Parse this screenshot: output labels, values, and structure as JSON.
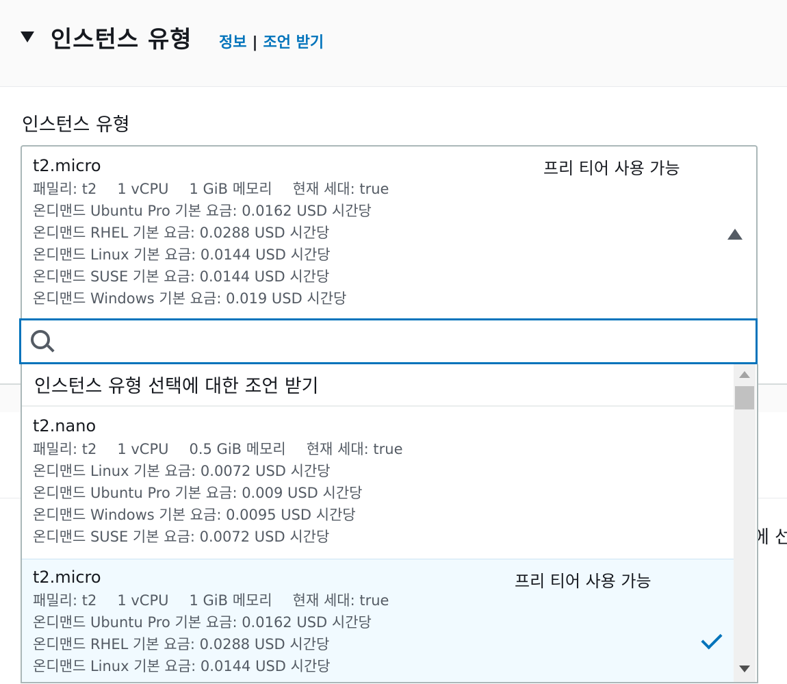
{
  "header": {
    "title": "인스턴스 유형",
    "info_link": "정보",
    "separator": "|",
    "advice_link": "조언 받기"
  },
  "field_label": "인스턴스 유형",
  "background_peek": "에 선",
  "selected": {
    "name": "t2.micro",
    "tag": "프리 티어 사용 가능",
    "family": "패밀리: t2",
    "vcpu": "1 vCPU",
    "memory": "1 GiB 메모리",
    "generation": "현재 세대: true",
    "prices": [
      "온디맨드 Ubuntu Pro 기본 요금: 0.0162 USD 시간당",
      "온디맨드 RHEL 기본 요금: 0.0288 USD 시간당",
      "온디맨드 Linux 기본 요금: 0.0144 USD 시간당",
      "온디맨드 SUSE 기본 요금: 0.0144 USD 시간당",
      "온디맨드 Windows 기본 요금: 0.019 USD 시간당"
    ]
  },
  "search": {
    "placeholder": "",
    "value": ""
  },
  "list": {
    "advice_text": "인스턴스 유형 선택에 대한 조언 받기",
    "items": [
      {
        "name": "t2.nano",
        "tag": "",
        "family": "패밀리: t2",
        "vcpu": "1 vCPU",
        "memory": "0.5 GiB 메모리",
        "generation": "현재 세대: true",
        "prices": [
          "온디맨드 Linux 기본 요금: 0.0072 USD 시간당",
          "온디맨드 Ubuntu Pro 기본 요금: 0.009 USD 시간당",
          "온디맨드 Windows 기본 요금: 0.0095 USD 시간당",
          "온디맨드 SUSE 기본 요금: 0.0072 USD 시간당"
        ]
      },
      {
        "name": "t2.micro",
        "tag": "프리 티어 사용 가능",
        "family": "패밀리: t2",
        "vcpu": "1 vCPU",
        "memory": "1 GiB 메모리",
        "generation": "현재 세대: true",
        "prices": [
          "온디맨드 Ubuntu Pro 기본 요금: 0.0162 USD 시간당",
          "온디맨드 RHEL 기본 요금: 0.0288 USD 시간당",
          "온디맨드 Linux 기본 요금: 0.0144 USD 시간당"
        ]
      }
    ]
  },
  "colors": {
    "link": "#0073bb",
    "focus_border": "#0073bb",
    "selected_bg": "#f1faff",
    "text": "#16191f",
    "secondary_text": "#545b64"
  },
  "icons": [
    "caret-down-icon",
    "caret-up-icon",
    "search-icon",
    "check-icon"
  ]
}
